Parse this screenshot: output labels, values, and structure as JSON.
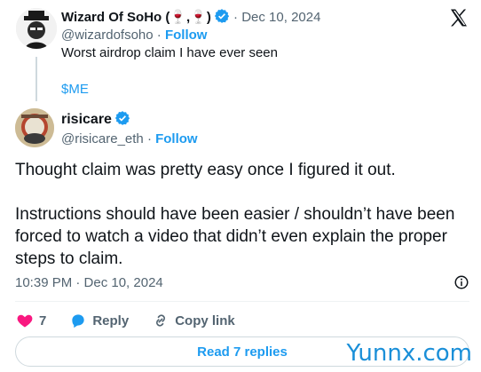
{
  "quoted": {
    "display_name": "Wizard Of SoHo (🍷,🍷)",
    "handle": "@wizardofsoho",
    "follow": "Follow",
    "date": "Dec 10, 2024",
    "text": "Worst airdrop claim I have ever seen",
    "cashtag": "$ME"
  },
  "main": {
    "display_name": "risicare",
    "handle": "@risicare_eth",
    "follow": "Follow",
    "paragraph1": "Thought claim was pretty easy once I figured it out.",
    "paragraph2": "Instructions should have been easier / shouldn’t have been forced to watch a video that didn’t even explain the proper steps to claim.",
    "time": "10:39 PM · Dec 10, 2024"
  },
  "actions": {
    "likes": "7",
    "reply_label": "Reply",
    "copy_label": "Copy link"
  },
  "read_replies": "Read 7 replies",
  "watermark": "Yunnx.com",
  "separator": "·",
  "colors": {
    "accent": "#1d9bf0",
    "like": "#f91880",
    "muted": "#536471"
  },
  "icons": [
    "verified-badge-icon",
    "x-logo-icon",
    "info-icon",
    "heart-icon",
    "reply-bubble-icon",
    "link-icon"
  ]
}
